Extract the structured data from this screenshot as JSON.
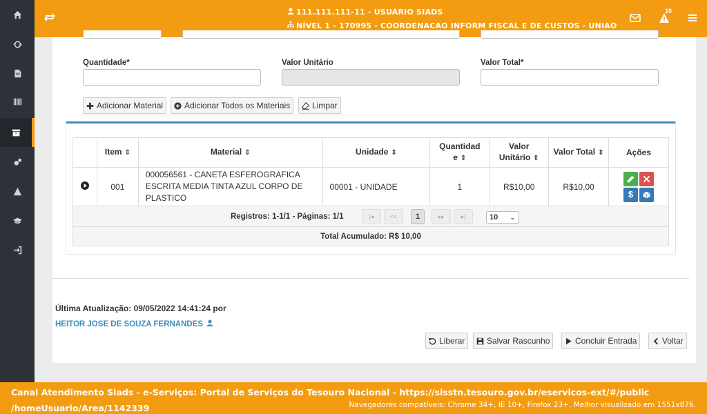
{
  "header": {
    "user": "111.111.111-11 - USUÁRIO SIADS",
    "unit": "NÍVEL 1 - 170995 - COORDENACAO INFORM FISCAL E DE CUSTOS - UNIAO",
    "alert_count": "10"
  },
  "form": {
    "quantity_label": "Quantidade*",
    "unit_value_label": "Valor Unitário",
    "total_value_label": "Valor Total*",
    "quantity_value": "",
    "unit_value_value": "",
    "total_value_value": ""
  },
  "buttons": {
    "add_material": "Adicionar Material",
    "add_all": "Adicionar Todos os Materiais",
    "clear": "Limpar"
  },
  "table": {
    "headers": [
      "Item",
      "Material",
      "Unidade",
      "Quantidade",
      "Valor Unitário",
      "Valor Total",
      "Ações"
    ],
    "header_quantidade_1": "Quantidad",
    "header_quantidade_2": "e",
    "header_valor_unit_1": "Valor",
    "header_valor_unit_2": "Unitário",
    "rows": [
      {
        "item": "001",
        "material": "000056561 - CANETA ESFEROGRAFICA ESCRITA MEDIA TINTA AZUL CORPO DE PLASTICO",
        "unidade": "00001 - UNIDADE",
        "quantidade": "1",
        "valor_unitario": "R$10,00",
        "valor_total": "R$10,00"
      }
    ]
  },
  "pager": {
    "summary": "Registros: 1-1/1 - Páginas: 1/1",
    "current_page": "1",
    "page_size": "10"
  },
  "total": "Total Acumulado: R$ 10,00",
  "last_update": {
    "label": "Última Atualização: 09/05/2022 14:41:24 por",
    "user": "HEITOR JOSE DE SOUZA FERNANDES"
  },
  "actions": {
    "release": "Liberar",
    "save_draft": "Salvar Rascunho",
    "finish": "Concluir Entrada",
    "back": "Voltar"
  },
  "footer": {
    "channel": "Canal Atendimento Siads - e-Serviços: Portal de Serviços do Tesouro Nacional - https://sisstn.tesouro.gov.br/eservicos-ext/#/public /homeUsuario/Area/1142339",
    "browsers": "Navegadores compatíveis: Chrome 34+, IE 10+, Firefox 23+. Melhor visualizado em 1551x876."
  },
  "colors": {
    "accent": "#f39c12",
    "sidebar": "#2d3238",
    "primary": "#3c8dbc",
    "edit": "#4cae4c",
    "delete": "#d9534f",
    "money": "#337ab7"
  }
}
